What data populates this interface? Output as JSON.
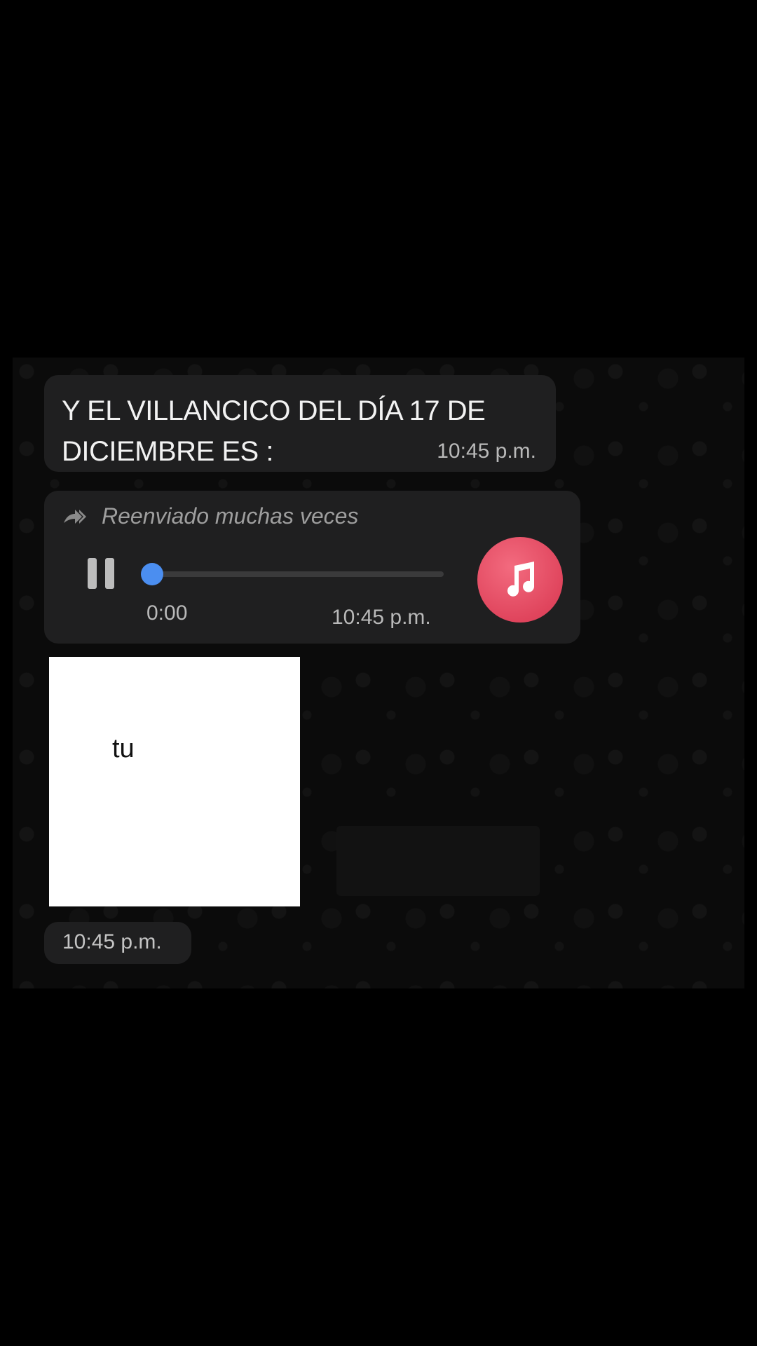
{
  "messages": {
    "text_message": {
      "body": "Y EL VILLANCICO DEL DÍA 17 DE DICIEMBRE ES :",
      "time": "10:45 p.m."
    },
    "audio_message": {
      "forwarded_label": "Reenviado muchas veces",
      "elapsed": "0:00",
      "time": "10:45 p.m.",
      "progress": 0,
      "icons": {
        "forward": "forwarded-many-times-icon",
        "pause": "pause-icon",
        "avatar": "music-note-icon"
      },
      "colors": {
        "progress": "#4b8ef0",
        "avatar": "#e0455d"
      }
    },
    "image_message": {
      "caption_in_image": "tu",
      "time": "10:45 p.m."
    }
  },
  "colors": {
    "background": "#000000",
    "bubble": "#1f1f20",
    "secondary_text": "#b9b9b9"
  }
}
